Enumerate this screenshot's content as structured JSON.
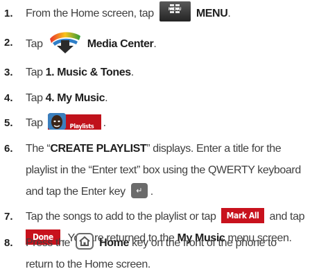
{
  "steps": [
    {
      "num": "1.",
      "pre": "From the Home screen, tap",
      "bold": "MENU",
      "post": "."
    },
    {
      "num": "2.",
      "pre": "Tap",
      "bold": "Media Center",
      "post": "."
    },
    {
      "num": "3.",
      "pre": "Tap",
      "bold": "1. Music & Tones",
      "post": "."
    },
    {
      "num": "4.",
      "pre": "Tap",
      "bold": "4. My Music",
      "post": "."
    },
    {
      "num": "5.",
      "pre": "Tap",
      "post": "."
    },
    {
      "num": "6.",
      "l1_pre": "The “",
      "l1_bold": "CREATE PLAYLIST",
      "l1_post": "” displays. Enter a title for the",
      "l2": "playlist in the “Enter text” box using the QWERTY keyboard",
      "l3_pre": "and tap the Enter key",
      "l3_post": "."
    },
    {
      "num": "7.",
      "l1_pre": "Tap the songs to add to the playlist or tap",
      "l1_post": "and tap",
      "l2_pre": ". You are returned to the",
      "l2_bold": "My Music",
      "l2_post": "menu screen."
    },
    {
      "num": "8.",
      "l1_pre": "Press the",
      "l1_bold": "Home",
      "l1_post": "key on the front of the phone to",
      "l2": "return to the Home screen."
    }
  ],
  "icons": {
    "menu": {
      "label": "MENU",
      "name": "menu-icon"
    },
    "playlists": {
      "label": "Playlists",
      "name": "playlists-icon"
    },
    "enter": {
      "glyph": "↵",
      "name": "enter-key-icon"
    },
    "home": {
      "name": "home-key-icon"
    }
  },
  "buttons": {
    "mark_all": "Mark All",
    "done": "Done"
  },
  "colors": {
    "accent_red": "#c8121d",
    "text": "#3f3f3f",
    "number": "#1d1d1d"
  }
}
